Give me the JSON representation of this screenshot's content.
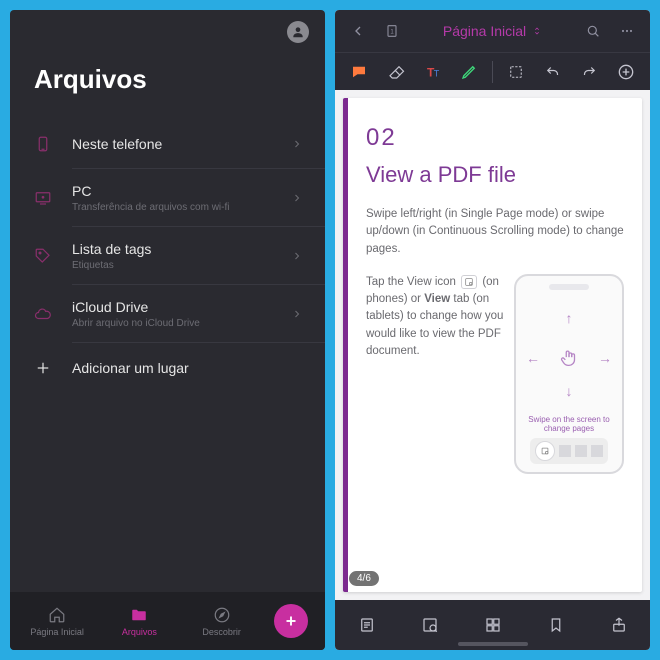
{
  "left": {
    "title": "Arquivos",
    "menu": [
      {
        "icon": "phone-icon",
        "label": "Neste telefone",
        "sub": ""
      },
      {
        "icon": "pc-icon",
        "label": "PC",
        "sub": "Transferência de arquivos com wi-fi"
      },
      {
        "icon": "tag-icon",
        "label": "Lista de tags",
        "sub": "Etiquetas"
      },
      {
        "icon": "cloud-icon",
        "label": "iCloud Drive",
        "sub": "Abrir arquivo no iCloud Drive"
      }
    ],
    "add_label": "Adicionar um lugar",
    "bottom": [
      {
        "label": "Página Inicial"
      },
      {
        "label": "Arquivos"
      },
      {
        "label": "Descobrir"
      }
    ]
  },
  "right": {
    "header_title": "Página Inicial",
    "page_badge": "4/6",
    "doc": {
      "section_num": "02",
      "heading": "View a PDF file",
      "para1": "Swipe left/right (in Single Page mode) or swipe up/down (in Continuous Scrolling mode) to change pages.",
      "para2a": "Tap the View icon ",
      "para2b": " (on phones) or ",
      "para2c": "View",
      "para2d": " tab (on tablets) to change how you would like to view the PDF document.",
      "phone_caption": "Swipe on the screen to change pages"
    }
  }
}
